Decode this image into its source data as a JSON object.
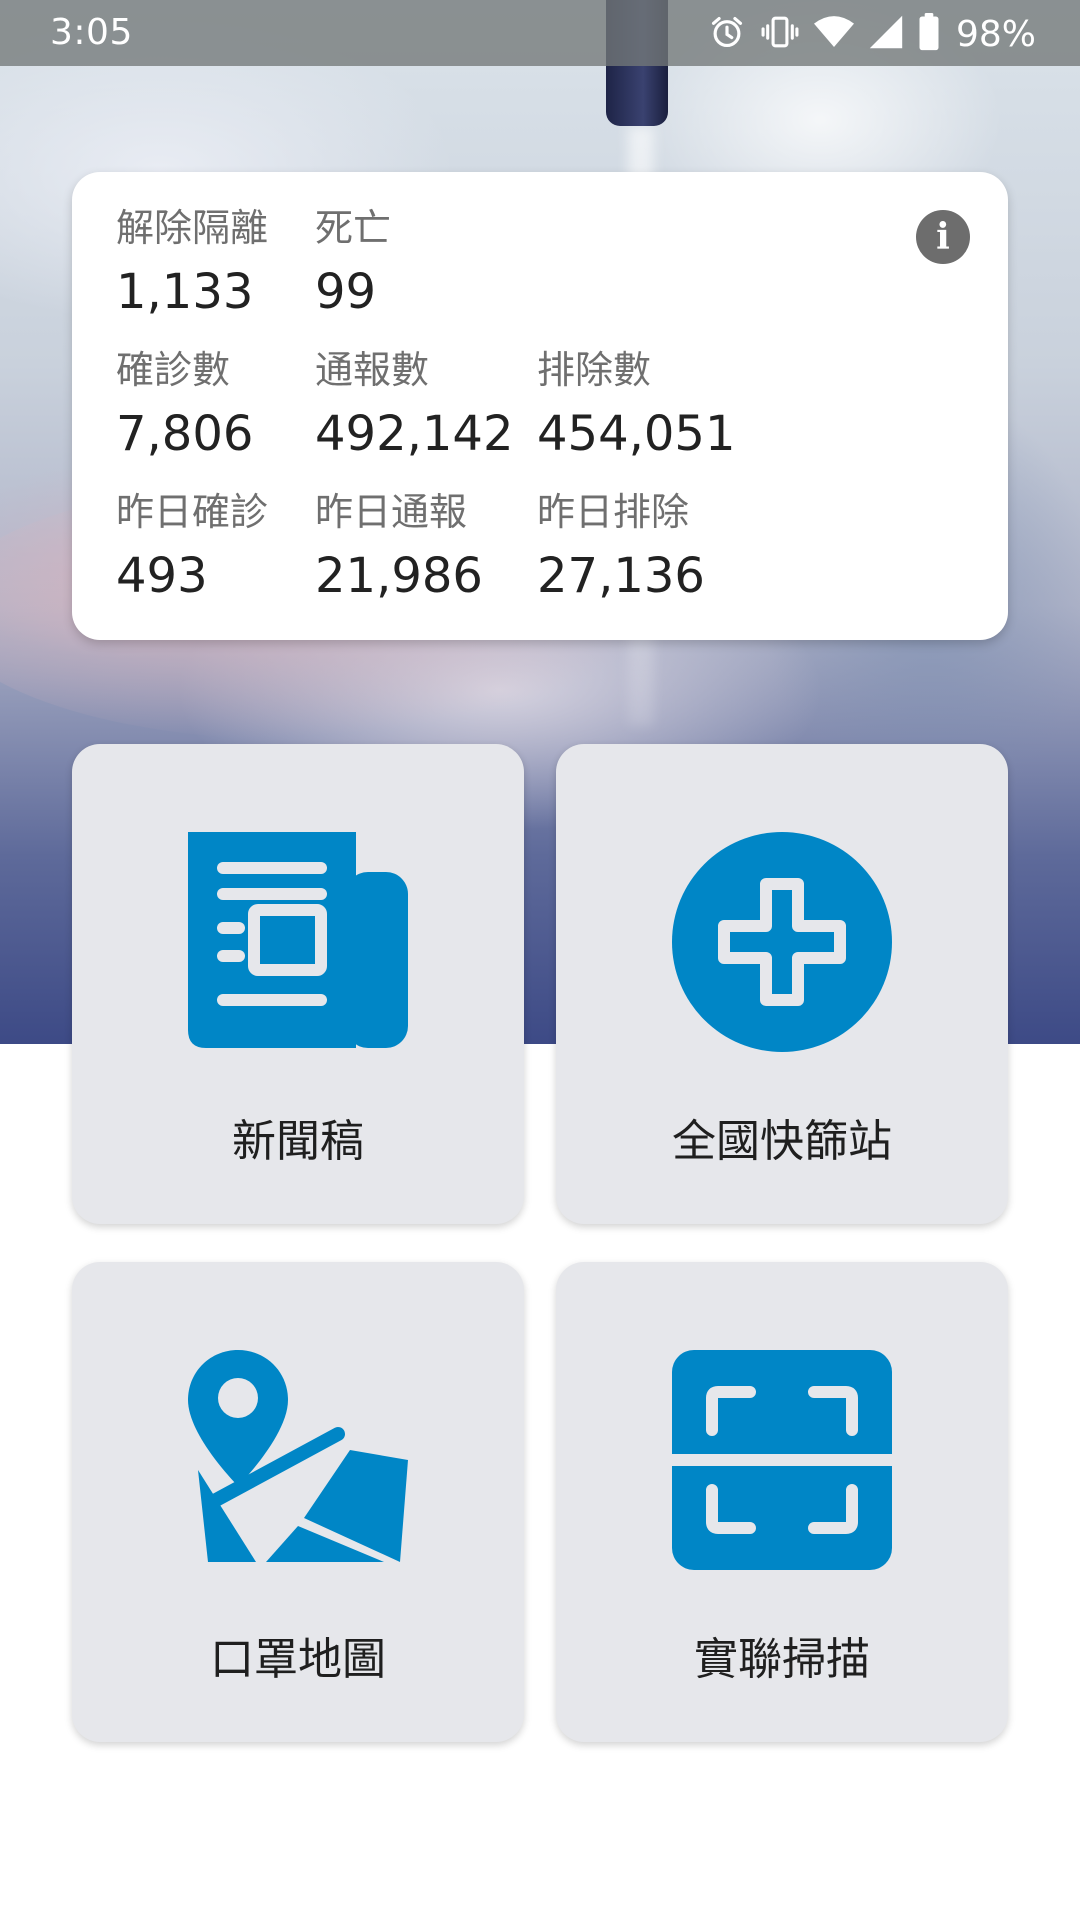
{
  "status_bar": {
    "time": "3:05",
    "battery": "98%",
    "icons": [
      "alarm-icon",
      "vibrate-icon",
      "wifi-icon",
      "signal-icon",
      "battery-icon"
    ]
  },
  "stats": {
    "recovered": {
      "label": "解除隔離",
      "value": "1,133"
    },
    "deaths": {
      "label": "死亡",
      "value": "99"
    },
    "confirmed": {
      "label": "確診數",
      "value": "7,806"
    },
    "reported": {
      "label": "通報數",
      "value": "492,142"
    },
    "excluded": {
      "label": "排除數",
      "value": "454,051"
    },
    "yesterday_confirmed": {
      "label": "昨日確診",
      "value": "493"
    },
    "yesterday_reported": {
      "label": "昨日通報",
      "value": "21,986"
    },
    "yesterday_excluded": {
      "label": "昨日排除",
      "value": "27,136"
    },
    "info_icon": "info-icon"
  },
  "tiles": [
    {
      "label": "新聞稿",
      "icon": "newspaper-icon"
    },
    {
      "label": "全國快篩站",
      "icon": "medical-cross-icon"
    },
    {
      "label": "口罩地圖",
      "icon": "map-pin-icon"
    },
    {
      "label": "實聯掃描",
      "icon": "qr-scan-icon"
    }
  ],
  "colors": {
    "accent": "#0086c6",
    "tile_background": "#e6e7eb",
    "card_background": "#ffffff"
  }
}
